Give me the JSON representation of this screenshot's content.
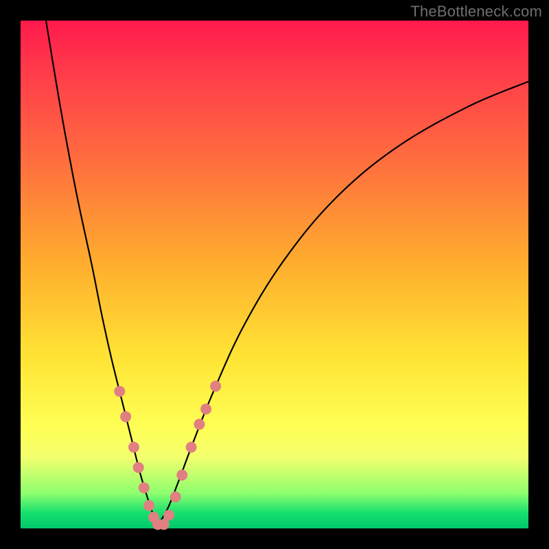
{
  "watermark": "TheBottleneck.com",
  "chart_data": {
    "type": "line",
    "title": "",
    "xlabel": "",
    "ylabel": "",
    "xlim": [
      0,
      100
    ],
    "ylim": [
      0,
      100
    ],
    "legend": false,
    "grid": false,
    "background_gradient": {
      "direction": "vertical",
      "stops": [
        {
          "pct": 0,
          "color": "#ff1a4d"
        },
        {
          "pct": 27,
          "color": "#ff6c3f"
        },
        {
          "pct": 48,
          "color": "#ffae2e"
        },
        {
          "pct": 66,
          "color": "#ffe334"
        },
        {
          "pct": 86,
          "color": "#f3ff6e"
        },
        {
          "pct": 97,
          "color": "#15e06e"
        },
        {
          "pct": 100,
          "color": "#00c76b"
        }
      ]
    },
    "series": [
      {
        "name": "left-branch",
        "x": [
          5,
          8,
          11,
          14,
          16,
          18,
          20,
          22,
          23.5,
          25,
          26,
          27
        ],
        "y": [
          100,
          82,
          66,
          52,
          42,
          33,
          25,
          17,
          11,
          6,
          3,
          0.5
        ]
      },
      {
        "name": "right-branch",
        "x": [
          27,
          29,
          31,
          34,
          38,
          44,
          52,
          62,
          74,
          88,
          100
        ],
        "y": [
          0.5,
          4,
          9,
          17,
          27,
          40,
          53,
          65,
          75,
          83,
          88
        ]
      }
    ],
    "markers": {
      "name": "highlight-points",
      "color": "#e08080",
      "radius_px": 8,
      "points": [
        {
          "x": 19.5,
          "y": 27
        },
        {
          "x": 20.7,
          "y": 22
        },
        {
          "x": 22.3,
          "y": 16
        },
        {
          "x": 23.2,
          "y": 12
        },
        {
          "x": 24.3,
          "y": 8
        },
        {
          "x": 25.3,
          "y": 4.5
        },
        {
          "x": 26.2,
          "y": 2.2
        },
        {
          "x": 27.0,
          "y": 0.8
        },
        {
          "x": 28.2,
          "y": 0.8
        },
        {
          "x": 29.2,
          "y": 2.6
        },
        {
          "x": 30.5,
          "y": 6.2
        },
        {
          "x": 31.8,
          "y": 10.5
        },
        {
          "x": 33.6,
          "y": 16
        },
        {
          "x": 35.2,
          "y": 20.5
        },
        {
          "x": 36.5,
          "y": 23.5
        },
        {
          "x": 38.4,
          "y": 28
        }
      ]
    }
  }
}
